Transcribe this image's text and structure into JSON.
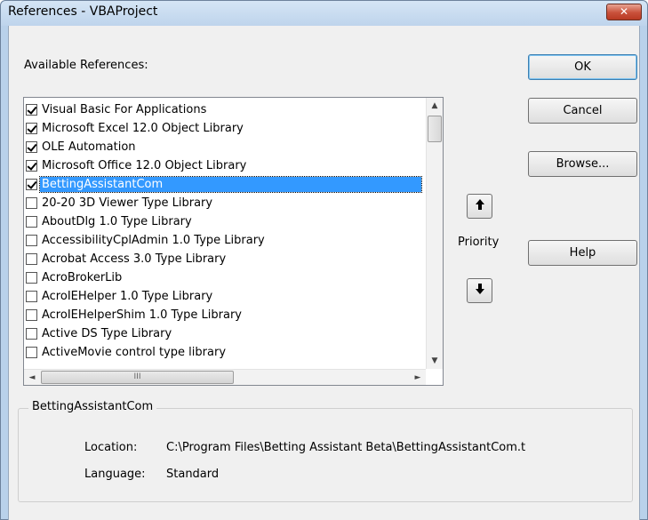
{
  "window": {
    "title": "References - VBAProject",
    "close_glyph": "✕"
  },
  "available_label": "Available References:",
  "references": [
    {
      "label": "Visual Basic For Applications",
      "checked": true
    },
    {
      "label": "Microsoft Excel 12.0 Object Library",
      "checked": true
    },
    {
      "label": "OLE Automation",
      "checked": true
    },
    {
      "label": "Microsoft Office 12.0 Object Library",
      "checked": true
    },
    {
      "label": "BettingAssistantCom",
      "checked": true,
      "selected": true
    },
    {
      "label": "20-20 3D Viewer Type Library",
      "checked": false
    },
    {
      "label": "AboutDlg 1.0 Type Library",
      "checked": false
    },
    {
      "label": "AccessibilityCplAdmin 1.0 Type Library",
      "checked": false
    },
    {
      "label": "Acrobat Access 3.0 Type Library",
      "checked": false
    },
    {
      "label": "AcroBrokerLib",
      "checked": false
    },
    {
      "label": "AcroIEHelper 1.0 Type Library",
      "checked": false
    },
    {
      "label": "AcroIEHelperShim 1.0 Type Library",
      "checked": false
    },
    {
      "label": "Active DS Type Library",
      "checked": false
    },
    {
      "label": "ActiveMovie control type library",
      "checked": false
    }
  ],
  "scroll": {
    "up_glyph": "▲",
    "down_glyph": "▼",
    "left_glyph": "◄",
    "right_glyph": "►",
    "hthumb_grip": "III"
  },
  "buttons": {
    "ok": "OK",
    "cancel": "Cancel",
    "browse": "Browse...",
    "help": "Help"
  },
  "priority": {
    "label": "Priority",
    "up_glyph": "🡅",
    "down_glyph": "🡇"
  },
  "details": {
    "group_title": "BettingAssistantCom",
    "location_label": "Location:",
    "location_value": "C:\\Program Files\\Betting Assistant Beta\\BettingAssistantCom.t",
    "language_label": "Language:",
    "language_value": "Standard"
  }
}
